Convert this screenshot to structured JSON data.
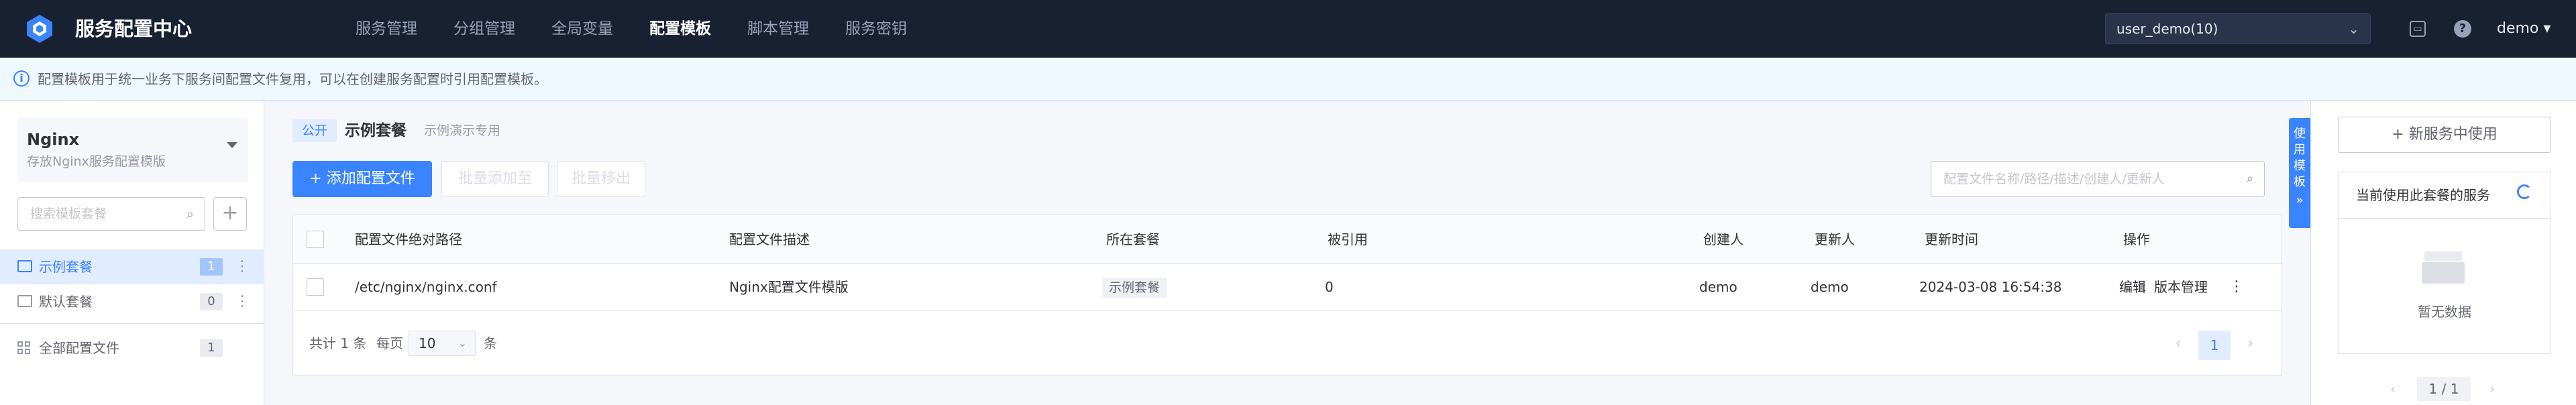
{
  "nav": {
    "title": "服务配置中心",
    "menu": [
      "服务管理",
      "分组管理",
      "全局变量",
      "配置模板",
      "脚本管理",
      "服务密钥"
    ],
    "active_menu": "配置模板",
    "biz_select": "user_demo(10)",
    "user": "demo"
  },
  "notice": {
    "text": "配置模板用于统一业务下服务间配置文件复用，可以在创建服务配置时引用配置模板。"
  },
  "sidebar": {
    "package_name": "Nginx",
    "package_desc": "存放Nginx服务配置模版",
    "search_placeholder": "搜索模板套餐",
    "add_icon": "plus-icon",
    "items": [
      {
        "label": "示例套餐",
        "count": "1",
        "active": true
      },
      {
        "label": "默认套餐",
        "count": "0",
        "active": false
      }
    ],
    "all_label": "全部配置文件",
    "all_count": "1"
  },
  "main": {
    "visibility_tag": "公开",
    "set_name": "示例套餐",
    "set_desc": "示例演示专用",
    "add_button": "+ 添加配置文件",
    "batch_add": "批量添加至",
    "batch_remove": "批量移出",
    "search_placeholder": "配置文件名称/路径/描述/创建人/更新人",
    "columns": [
      "配置文件绝对路径",
      "配置文件描述",
      "所在套餐",
      "被引用",
      "创建人",
      "更新人",
      "更新时间",
      "操作"
    ],
    "rows": [
      {
        "path": "/etc/nginx/nginx.conf",
        "desc": "Nginx配置文件模版",
        "set": "示例套餐",
        "refs": "0",
        "creator": "demo",
        "updater": "demo",
        "updated_at": "2024-03-08 16:54:38",
        "action_edit": "编辑",
        "action_versions": "版本管理"
      }
    ],
    "footer": {
      "total": "共计 1 条",
      "per_page_label": "每页",
      "per_page": "10",
      "unit": "条",
      "current_page": "1"
    }
  },
  "side_tab": {
    "chars": [
      "使",
      "用",
      "模",
      "板"
    ]
  },
  "right_panel": {
    "new_service_button": "+ 新服务中使用",
    "title": "当前使用此套餐的服务",
    "empty_text": "暂无数据",
    "pager": "1 / 1"
  }
}
